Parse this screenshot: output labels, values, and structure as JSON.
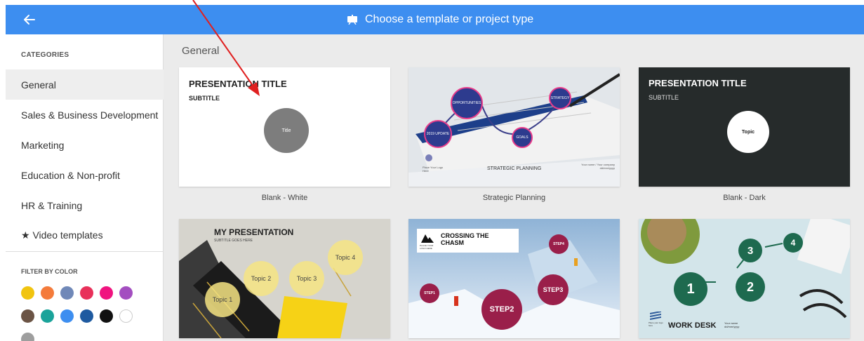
{
  "header": {
    "title": "Choose a template or project type",
    "back_icon": "arrow-left-icon",
    "title_icon": "presentation-board-icon",
    "color": "#3d8ef0"
  },
  "sidebar": {
    "categories_header": "CATEGORIES",
    "items": [
      {
        "label": "General",
        "active": true
      },
      {
        "label": "Sales & Business Development"
      },
      {
        "label": "Marketing"
      },
      {
        "label": "Education & Non-profit"
      },
      {
        "label": "HR & Training"
      },
      {
        "label": "★ Video templates"
      }
    ],
    "filter_header": "FILTER BY COLOR",
    "colors": [
      "#f1c40f",
      "#f47b3b",
      "#7088b8",
      "#e8305a",
      "#f0137f",
      "#a34ec0",
      "#6b5445",
      "#1aa39a",
      "#3d8ef0",
      "#1e5aa0",
      "#111111",
      "#ffffff",
      "#9e9e9e"
    ]
  },
  "main": {
    "section_title": "General",
    "templates": [
      {
        "label": "Blank - White",
        "title": "PRESENTATION TITLE",
        "subtitle": "SUBTITLE",
        "center": "Title"
      },
      {
        "label": "Strategic Planning",
        "footer": "STRATEGIC PLANNING",
        "logo": "Place Your Logo Here",
        "meta": "Your name / Your company dd/mm/yyyy",
        "bubbles": [
          "OPPORTUNITIES",
          "STRATEGY",
          "2019 UPDATE",
          "GOALS"
        ]
      },
      {
        "label": "Blank - Dark",
        "title": "PRESENTATION TITLE",
        "subtitle": "SUBTITLE",
        "center": "Topic"
      },
      {
        "title": "MY PRESENTATION",
        "subtitle": "SUBTITLE GOES HERE",
        "topics": [
          "Topic 1",
          "Topic 2",
          "Topic 3",
          "Topic 4"
        ]
      },
      {
        "title": "CROSSING THE CHASM",
        "logo": "PLACE YOUR LOGO HERE",
        "steps": [
          "STEP1",
          "STEP2",
          "STEP3",
          "STEP4"
        ]
      },
      {
        "title": "WORK DESK",
        "meta": "Your name dd/mm/yyyy",
        "logo": "Place your logo here",
        "numbers": [
          "1",
          "2",
          "3",
          "4"
        ]
      }
    ]
  }
}
